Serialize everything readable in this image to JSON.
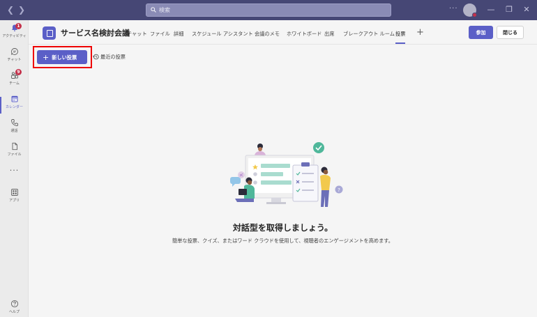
{
  "titlebar": {
    "search_placeholder": "検索",
    "more": "···"
  },
  "rail": {
    "items": [
      {
        "label": "アクティビティ",
        "icon": "bell-icon",
        "badge": "1"
      },
      {
        "label": "チャット",
        "icon": "chat-icon"
      },
      {
        "label": "チーム",
        "icon": "teams-icon",
        "badge": "9"
      },
      {
        "label": "カレンダー",
        "icon": "calendar-icon",
        "active": true
      },
      {
        "label": "通話",
        "icon": "phone-icon"
      },
      {
        "label": "ファイル",
        "icon": "file-icon"
      },
      {
        "label": "アプリ",
        "icon": "apps-icon"
      },
      {
        "label": "ヘルプ",
        "icon": "help-icon"
      }
    ],
    "more": "···"
  },
  "header": {
    "title": "サービス名検討会議",
    "tabs": [
      {
        "label": "チャット"
      },
      {
        "label": "ファイル"
      },
      {
        "label": "詳細"
      },
      {
        "label": "スケジュール アシスタント"
      },
      {
        "label": "会議のメモ"
      },
      {
        "label": "ホワイトボード"
      },
      {
        "label": "出席"
      },
      {
        "label": "ブレークアウト ルーム"
      },
      {
        "label": "投票",
        "active": true
      }
    ],
    "add_tab": "+",
    "join_label": "参加",
    "close_label": "閉じる"
  },
  "content": {
    "new_poll_label": "新しい投票",
    "recent_polls_label": "最近の投票",
    "empty_title": "対話型を取得しましょう。",
    "empty_description": "簡単な投票、クイズ、またはワード クラウドを使用して、視聴者のエンゲージメントを高めます。"
  },
  "colors": {
    "titlebar": "#464775",
    "accent": "#5b5fc7",
    "badge": "#c4314b",
    "highlight": "#ee0000"
  }
}
